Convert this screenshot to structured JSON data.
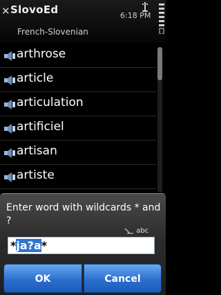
{
  "titlebar": {
    "close_icon": "close-icon",
    "app_title": "SlovoEd",
    "clock": "6:18 PM",
    "subtitle": "French-Slovenian"
  },
  "wordlist": {
    "items": [
      {
        "word": "arthrose",
        "icon": "speaker-icon"
      },
      {
        "word": "article",
        "icon": "speaker-icon"
      },
      {
        "word": "articulation",
        "icon": "speaker-icon"
      },
      {
        "word": "artificiel",
        "icon": "speaker-icon"
      },
      {
        "word": "artisan",
        "icon": "speaker-icon"
      },
      {
        "word": "artiste",
        "icon": "speaker-icon"
      }
    ]
  },
  "dialog": {
    "prompt": "Enter word with wildcards * and ?",
    "input_mode": "abc",
    "input": {
      "prefix": "*",
      "selected": "ja?a",
      "suffix": "*"
    },
    "ok_label": "OK",
    "cancel_label": "Cancel"
  },
  "colors": {
    "accent": "#2d74d0",
    "button": "#2b6fcf"
  }
}
